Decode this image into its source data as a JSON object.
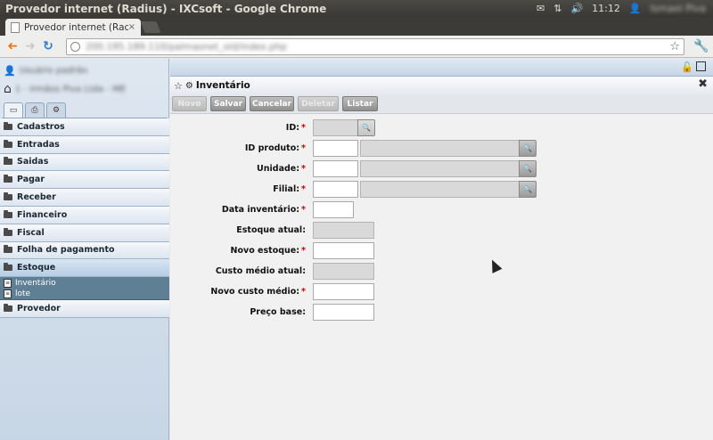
{
  "os": {
    "window_title": "Provedor internet (Radius) - IXCsoft - Google Chrome",
    "clock": "11:12",
    "user_name": "Ismael Piva",
    "tray_icons": [
      "mail-icon",
      "network-icon",
      "volume-icon",
      "user-icon"
    ]
  },
  "browser": {
    "tab_label": "Provedor internet (Radius",
    "tab_close": "×",
    "url": "200.195.189.110/palmasnet_old/index.php"
  },
  "sidebar": {
    "user_label": "Usuário padrão",
    "home_label": "1 - Irmãos Piva Ltda - ME",
    "menu": [
      {
        "label": "Cadastros"
      },
      {
        "label": "Entradas"
      },
      {
        "label": "Saidas"
      },
      {
        "label": "Pagar"
      },
      {
        "label": "Receber"
      },
      {
        "label": "Financeiro"
      },
      {
        "label": "Fiscal"
      },
      {
        "label": "Folha de pagamento"
      },
      {
        "label": "Estoque",
        "open": true
      },
      {
        "label": "Provedor"
      }
    ],
    "estoque_sub": [
      "Inventário",
      "lote"
    ]
  },
  "panel": {
    "title": "Inventário",
    "close": "✖",
    "toolbar": {
      "novo": "Novo",
      "salvar": "Salvar",
      "cancelar": "Cancelar",
      "deletar": "Deletar",
      "listar": "Listar"
    }
  },
  "form": {
    "id": "ID:",
    "id_produto": "ID produto:",
    "unidade": "Unidade:",
    "filial": "Filial:",
    "data_inventario": "Data inventário:",
    "estoque_atual": "Estoque atual:",
    "novo_estoque": "Novo estoque:",
    "custo_medio_atual": "Custo médio atual:",
    "novo_custo_medio": "Novo custo médio:",
    "preco_base": "Preço base:",
    "required_mark": "*"
  },
  "icons": {
    "search": "🔍"
  }
}
